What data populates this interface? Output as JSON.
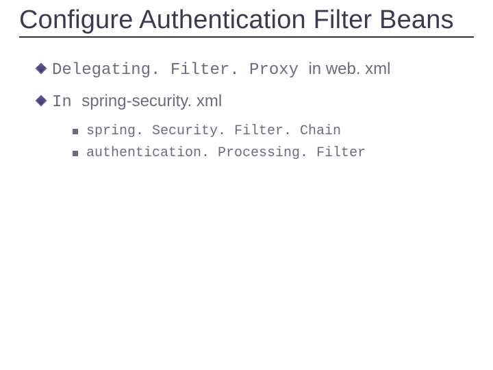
{
  "title": "Configure Authentication Filter Beans",
  "bullets": [
    {
      "segments": [
        {
          "text": "Delegating. Filter. Proxy ",
          "style": "mono"
        },
        {
          "text": "in web. xml",
          "style": "sans"
        }
      ]
    },
    {
      "segments": [
        {
          "text": "In ",
          "style": "mono"
        },
        {
          "text": "spring-security. xml",
          "style": "sans"
        }
      ],
      "sub": [
        "spring. Security. Filter. Chain",
        "authentication. Processing. Filter"
      ]
    }
  ]
}
